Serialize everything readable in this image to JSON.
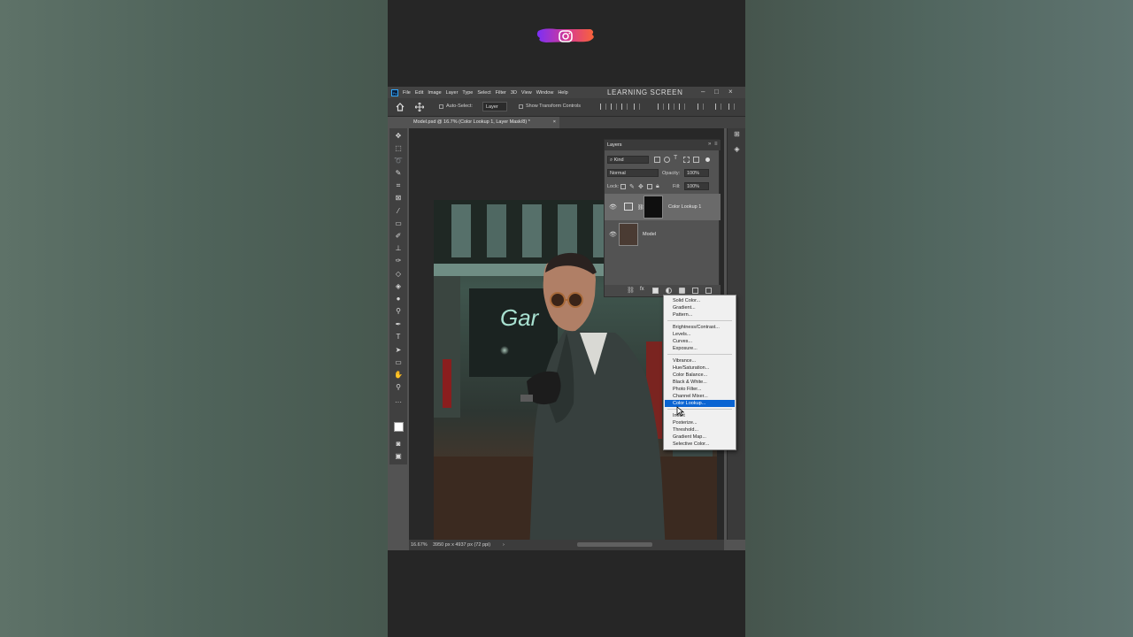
{
  "app": {
    "logo_label": "Ps",
    "window_title": "LEARNING SCREEN",
    "menu": [
      "File",
      "Edit",
      "Image",
      "Layer",
      "Type",
      "Select",
      "Filter",
      "3D",
      "View",
      "Window",
      "Help"
    ],
    "window_controls": [
      "–",
      "□",
      "×"
    ]
  },
  "options_bar": {
    "auto_select_label": "Auto-Select:",
    "auto_select_value": "Layer",
    "show_transform_label": "Show Transform Controls"
  },
  "document": {
    "tab_title": "Model.psd @ 16.7% (Color Lookup 1, Layer Mask/8) *",
    "close": "×"
  },
  "status": {
    "zoom": "16.67%",
    "info": "3950 px x 4937 px (72 ppi)",
    "arrow": "›"
  },
  "layers_panel": {
    "title": "Layers",
    "collapse": "»",
    "menu": "≡",
    "filter_label": "Kind",
    "blend_mode": "Normal",
    "opacity_label": "Opacity:",
    "opacity_value": "100%",
    "lock_label": "Lock:",
    "fill_label": "Fill:",
    "fill_value": "100%",
    "layers": [
      {
        "name": "Color Lookup 1",
        "visible": true,
        "selected": true
      },
      {
        "name": "Model",
        "visible": true,
        "selected": false
      }
    ]
  },
  "adjustment_menu": {
    "items": [
      "Solid Color...",
      "Gradient...",
      "Pattern...",
      "Brightness/Contrast...",
      "Levels...",
      "Curves...",
      "Exposure...",
      "Vibrance...",
      "Hue/Saturation...",
      "Color Balance...",
      "Black & White...",
      "Photo Filter...",
      "Channel Mixer...",
      "Color Lookup...",
      "Invert",
      "Posterize...",
      "Threshold...",
      "Gradient Map...",
      "Selective Color..."
    ],
    "active_item": "Color Lookup..."
  },
  "photo": {
    "sign_text": "Gar"
  },
  "colors": {
    "accent": "#0a64d2",
    "ps_blue": "#31a8ff",
    "panel_bg": "#535353",
    "canvas_bg": "#282828",
    "instagram_gradient": [
      "#7b2ff7",
      "#f9643a"
    ]
  },
  "icons": [
    "instagram-icon",
    "home-icon",
    "move-icon",
    "eye-icon",
    "lock-icon",
    "fx-icon",
    "mask-icon",
    "adjustment-icon",
    "folder-icon",
    "new-layer-icon",
    "trash-icon"
  ]
}
